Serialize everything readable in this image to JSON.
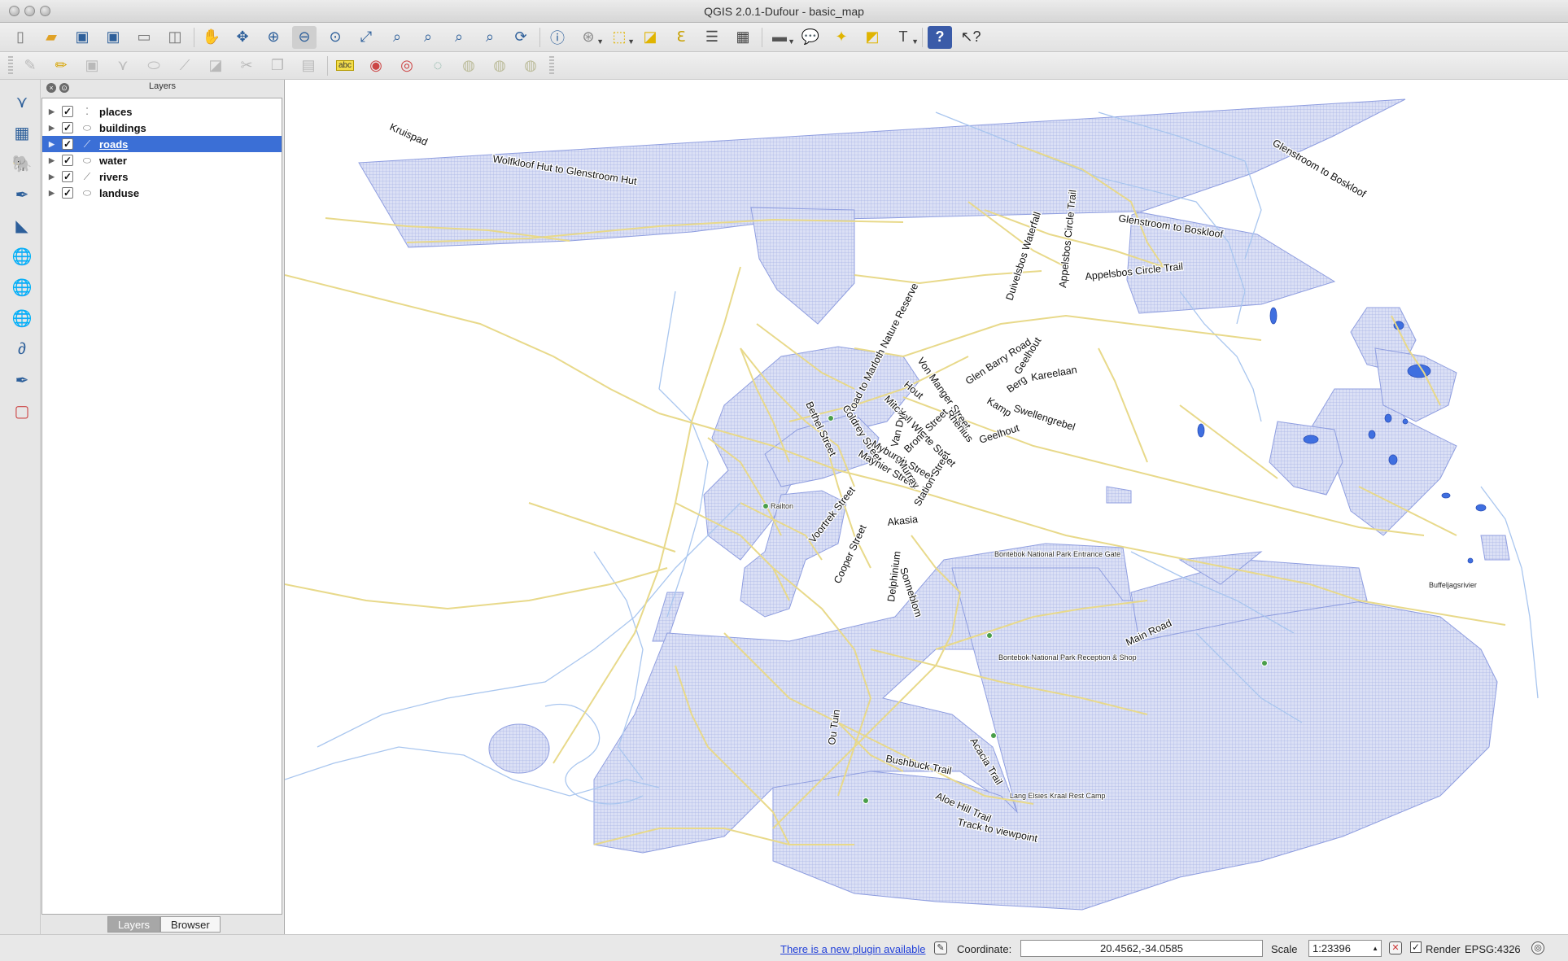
{
  "window": {
    "title": "QGIS 2.0.1-Dufour - basic_map"
  },
  "toolbar_main": {
    "icons": [
      "new-project",
      "open-project",
      "save-project",
      "save-as",
      "print-composer",
      "composer-manager",
      "pan",
      "pan-to-selection",
      "zoom-in",
      "zoom-out",
      "zoom-actual",
      "zoom-full",
      "zoom-to-selection",
      "zoom-to-layer",
      "zoom-last",
      "zoom-next",
      "refresh",
      "identify",
      "select",
      "deselect",
      "measure",
      "attribute-table",
      "field-calculator",
      "annotation",
      "text-annotation",
      "tips",
      "help",
      "whats-this"
    ]
  },
  "toolbar_labels": {
    "abc": "abc"
  },
  "layers_panel": {
    "title": "Layers",
    "layers": [
      {
        "name": "places",
        "checked": true,
        "icon": "point-layer-icon",
        "selected": false
      },
      {
        "name": "buildings",
        "checked": true,
        "icon": "polygon-layer-icon",
        "selected": false
      },
      {
        "name": "roads",
        "checked": true,
        "icon": "line-layer-icon",
        "selected": true
      },
      {
        "name": "water",
        "checked": true,
        "icon": "polygon-layer-icon",
        "selected": false
      },
      {
        "name": "rivers",
        "checked": true,
        "icon": "line-layer-icon",
        "selected": false
      },
      {
        "name": "landuse",
        "checked": true,
        "icon": "polygon-layer-icon",
        "selected": false
      }
    ],
    "tabs": [
      {
        "label": "Layers",
        "active": true
      },
      {
        "label": "Browser",
        "active": false
      }
    ]
  },
  "map": {
    "colors": {
      "road": "#e8d98a",
      "river": "#a9c6ef",
      "landuse_fill": "#c9d2ef",
      "landuse_stroke": "#8f9ee0",
      "water": "#3f6fe0",
      "place_point": "#4a9e4a"
    },
    "road_labels": [
      "Kruispad",
      "Wolfkloof Hut to Glenstroom Hut",
      "Glenstroom to Boskloof",
      "Glenstroom to Boskloof",
      "Appelsbos Circle Trail",
      "Appelsbos Circle Trail",
      "Duivelsbos Waterfall",
      "Road to Marloth Nature Reserve",
      "Von Manger Street",
      "Glen Barry Road",
      "Geelhout",
      "Kareelaan",
      "Berg",
      "Kamp",
      "Hout",
      "Mitchell Whyte Street",
      "Rhenius",
      "Van Dyk",
      "Coldrey Street",
      "Bethel Street",
      "Swellengrebel",
      "Geelhout",
      "Bronn Street",
      "Myburgh Street",
      "Maynier Street",
      "Murray",
      "Station Street",
      "Voortrek Street",
      "Akasia",
      "Cooper Street",
      "Delphinium",
      "Sonneblom",
      "Main Road",
      "Ou Tuin",
      "Bushbuck Trail",
      "Acacia Trail",
      "Aloe Hill Trail",
      "Track to viewpoint"
    ],
    "place_labels": [
      "Railton",
      "Bontebok National Park Entrance Gate",
      "Buffeljagsrivier",
      "Bontebok National Park Reception & Shop",
      "Lang Elsies Kraal Rest Camp"
    ]
  },
  "statusbar": {
    "plugin_notice": "There is a new plugin available",
    "coordinate_label": "Coordinate:",
    "coordinate_value": "20.4562,-34.0585",
    "scale_label": "Scale",
    "scale_value": "1:23396",
    "render_label": "Render",
    "render_checked": true,
    "crs": "EPSG:4326"
  }
}
